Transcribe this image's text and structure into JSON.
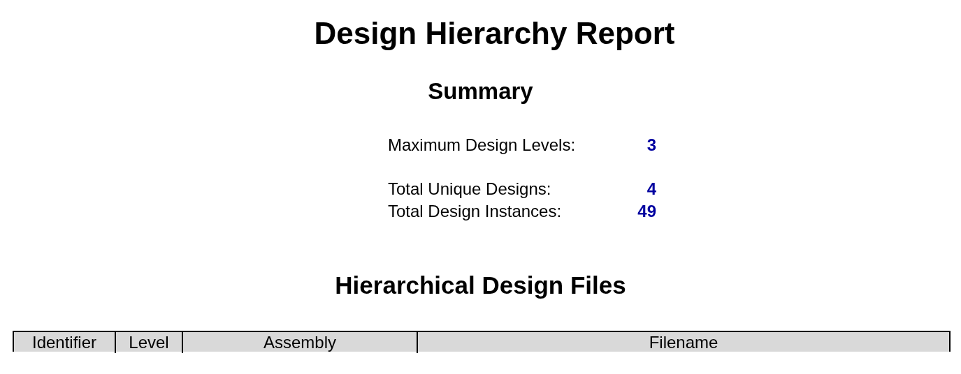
{
  "title": "Design Hierarchy Report",
  "summary": {
    "heading": "Summary",
    "groups": [
      [
        {
          "label": "Maximum Design Levels:",
          "value": "3"
        }
      ],
      [
        {
          "label": "Total Unique Designs:",
          "value": "4"
        },
        {
          "label": "Total Design Instances:",
          "value": "49"
        }
      ]
    ]
  },
  "files": {
    "heading": "Hierarchical Design Files",
    "columns": [
      "Identifier",
      "Level",
      "Assembly",
      "Filename"
    ]
  }
}
